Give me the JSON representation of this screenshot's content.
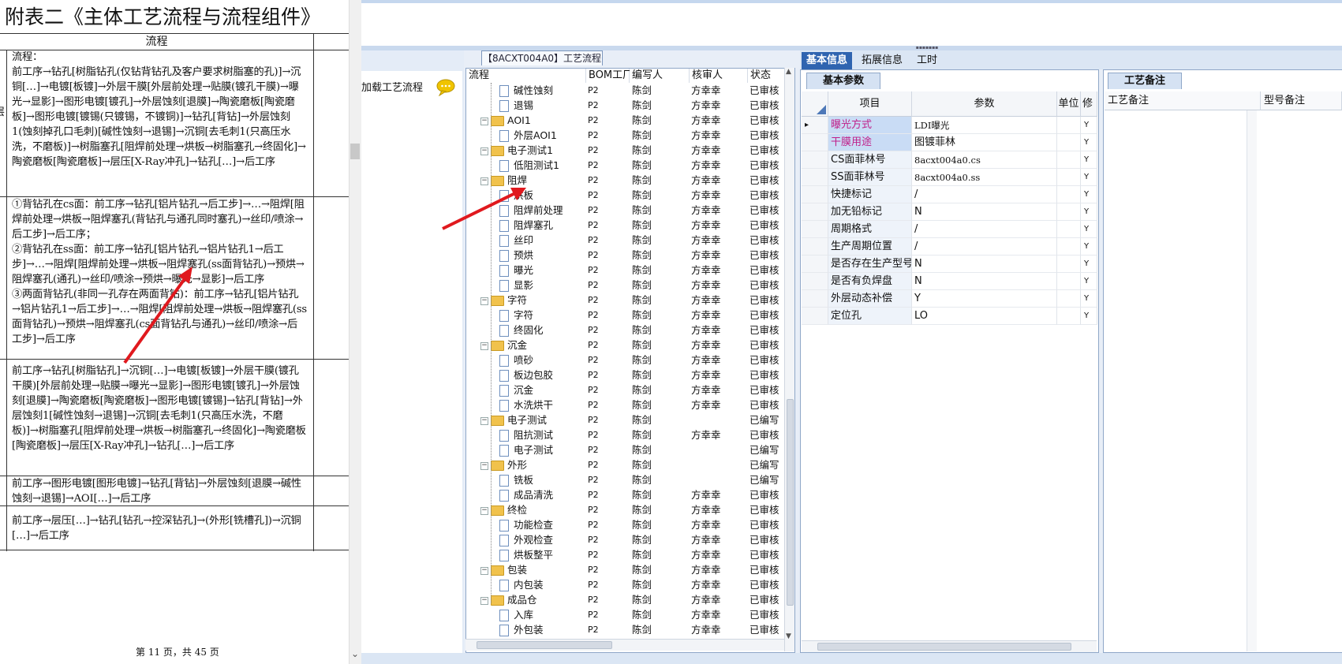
{
  "document": {
    "title": "附表二《主体工艺流程与流程组件》",
    "column_header": "流程",
    "left_mark": "层",
    "cells": [
      "流程：\n前工序→钻孔[树脂钻孔(仅钻背钻孔及客户要求树脂塞的孔)]→沉铜[…]→电镀[板镀]→外层干膜[外层前处理→贴膜(镀孔干膜)→曝光→显影]→图形电镀[镀孔]→外层蚀刻[退膜]→陶瓷磨板[陶瓷磨板]→图形电镀[镀锡(只镀锡，不镀铜)]→钻孔[背钻]→外层蚀刻1(蚀刻掉孔口毛刺)[碱性蚀刻→退锡]→沉铜[去毛刺1(只高压水洗，不磨板)]→树脂塞孔[阻焊前处理→烘板→树脂塞孔→终固化]→陶瓷磨板[陶瓷磨板]→层压[X-Ray冲孔]→钻孔[…]→后工序",
      "①背钻孔在cs面：前工序→钻孔[铝片钻孔→后工步]→…→阻焊[阻焊前处理→烘板→阻焊塞孔(背钻孔与通孔同时塞孔)→丝印/喷涂→后工步]→后工序；\n②背钻孔在ss面：前工序→钻孔[铝片钻孔→铝片钻孔1→后工步]→…→阻焊[阻焊前处理→烘板→阻焊塞孔(ss面背钻孔)→预烘→阻焊塞孔(通孔)→丝印/喷涂→预烘→曝光→显影]→后工序\n③两面背钻孔(非同一孔存在两面背钻)：前工序→钻孔[铝片钻孔→铝片钻孔1→后工步]→…→阻焊[阻焊前处理→烘板→阻焊塞孔(ss面背钻孔)→预烘→阻焊塞孔(cs面背钻孔与通孔)→丝印/喷涂→后工步]→后工序",
      "前工序→钻孔[树脂钻孔]→沉铜[…]→电镀[板镀]→外层干膜(镀孔干膜)[外层前处理→贴膜→曝光→显影]→图形电镀[镀孔]→外层蚀刻[退膜]→陶瓷磨板[陶瓷磨板]→图形电镀[镀锡]→钻孔[背钻]→外层蚀刻1[碱性蚀刻→退锡]→沉铜[去毛刺1(只高压水洗，不磨板)]→树脂塞孔[阻焊前处理→烘板→树脂塞孔→终固化]→陶瓷磨板[陶瓷磨板]→层压[X-Ray冲孔]→钻孔[…]→后工序",
      "前工序→图形电镀[图形电镀]→钻孔[背钻]→外层蚀刻[退膜→碱性蚀刻→退锡]→AOI[…]→后工序",
      "前工序→层压[…]→钻孔[钻孔→控深钻孔]→(外形[铣槽孔])→沉铜[…]→后工序"
    ],
    "page_number": "第 11 页，共 45 页"
  },
  "left_panel": {
    "load_label": "加载工艺流程",
    "icon": "speech-bubble-icon"
  },
  "tree": {
    "tab_label": "【8ACXT004A0】工艺流程",
    "columns": [
      "流程",
      "BOM工厂",
      "编写人",
      "核审人",
      "状态"
    ],
    "rows": [
      {
        "name": "碱性蚀刻",
        "level": 1,
        "bom": "P2",
        "writer": "陈剑",
        "reviewer": "方幸幸",
        "status": "已审核"
      },
      {
        "name": "退锡",
        "level": 1,
        "bom": "P2",
        "writer": "陈剑",
        "reviewer": "方幸幸",
        "status": "已审核"
      },
      {
        "name": "AOI1",
        "level": 0,
        "bom": "P2",
        "writer": "陈剑",
        "reviewer": "方幸幸",
        "status": "已审核"
      },
      {
        "name": "外层AOI1",
        "level": 1,
        "bom": "P2",
        "writer": "陈剑",
        "reviewer": "方幸幸",
        "status": "已审核"
      },
      {
        "name": "电子测试1",
        "level": 0,
        "bom": "P2",
        "writer": "陈剑",
        "reviewer": "方幸幸",
        "status": "已审核"
      },
      {
        "name": "低阻测试1",
        "level": 1,
        "bom": "P2",
        "writer": "陈剑",
        "reviewer": "方幸幸",
        "status": "已审核"
      },
      {
        "name": "阻焊",
        "level": 0,
        "bom": "P2",
        "writer": "陈剑",
        "reviewer": "方幸幸",
        "status": "已审核"
      },
      {
        "name": "烘板",
        "level": 1,
        "bom": "P2",
        "writer": "陈剑",
        "reviewer": "方幸幸",
        "status": "已审核"
      },
      {
        "name": "阻焊前处理",
        "level": 1,
        "bom": "P2",
        "writer": "陈剑",
        "reviewer": "方幸幸",
        "status": "已审核"
      },
      {
        "name": "阻焊塞孔",
        "level": 1,
        "bom": "P2",
        "writer": "陈剑",
        "reviewer": "方幸幸",
        "status": "已审核"
      },
      {
        "name": "丝印",
        "level": 1,
        "bom": "P2",
        "writer": "陈剑",
        "reviewer": "方幸幸",
        "status": "已审核"
      },
      {
        "name": "预烘",
        "level": 1,
        "bom": "P2",
        "writer": "陈剑",
        "reviewer": "方幸幸",
        "status": "已审核"
      },
      {
        "name": "曝光",
        "level": 1,
        "bom": "P2",
        "writer": "陈剑",
        "reviewer": "方幸幸",
        "status": "已审核"
      },
      {
        "name": "显影",
        "level": 1,
        "bom": "P2",
        "writer": "陈剑",
        "reviewer": "方幸幸",
        "status": "已审核"
      },
      {
        "name": "字符",
        "level": 0,
        "bom": "P2",
        "writer": "陈剑",
        "reviewer": "方幸幸",
        "status": "已审核"
      },
      {
        "name": "字符",
        "level": 1,
        "bom": "P2",
        "writer": "陈剑",
        "reviewer": "方幸幸",
        "status": "已审核"
      },
      {
        "name": "终固化",
        "level": 1,
        "bom": "P2",
        "writer": "陈剑",
        "reviewer": "方幸幸",
        "status": "已审核"
      },
      {
        "name": "沉金",
        "level": 0,
        "bom": "P2",
        "writer": "陈剑",
        "reviewer": "方幸幸",
        "status": "已审核"
      },
      {
        "name": "喷砂",
        "level": 1,
        "bom": "P2",
        "writer": "陈剑",
        "reviewer": "方幸幸",
        "status": "已审核"
      },
      {
        "name": "板边包胶",
        "level": 1,
        "bom": "P2",
        "writer": "陈剑",
        "reviewer": "方幸幸",
        "status": "已审核"
      },
      {
        "name": "沉金",
        "level": 1,
        "bom": "P2",
        "writer": "陈剑",
        "reviewer": "方幸幸",
        "status": "已审核"
      },
      {
        "name": "水洗烘干",
        "level": 1,
        "bom": "P2",
        "writer": "陈剑",
        "reviewer": "方幸幸",
        "status": "已审核"
      },
      {
        "name": "电子测试",
        "level": 0,
        "bom": "P2",
        "writer": "陈剑",
        "reviewer": "",
        "status": "已编写"
      },
      {
        "name": "阻抗测试",
        "level": 1,
        "bom": "P2",
        "writer": "陈剑",
        "reviewer": "方幸幸",
        "status": "已审核"
      },
      {
        "name": "电子测试",
        "level": 1,
        "bom": "P2",
        "writer": "陈剑",
        "reviewer": "",
        "status": "已编写"
      },
      {
        "name": "外形",
        "level": 0,
        "bom": "P2",
        "writer": "陈剑",
        "reviewer": "",
        "status": "已编写"
      },
      {
        "name": "铣板",
        "level": 1,
        "bom": "P2",
        "writer": "陈剑",
        "reviewer": "",
        "status": "已编写"
      },
      {
        "name": "成品清洗",
        "level": 1,
        "bom": "P2",
        "writer": "陈剑",
        "reviewer": "方幸幸",
        "status": "已审核"
      },
      {
        "name": "终检",
        "level": 0,
        "bom": "P2",
        "writer": "陈剑",
        "reviewer": "方幸幸",
        "status": "已审核"
      },
      {
        "name": "功能检查",
        "level": 1,
        "bom": "P2",
        "writer": "陈剑",
        "reviewer": "方幸幸",
        "status": "已审核"
      },
      {
        "name": "外观检查",
        "level": 1,
        "bom": "P2",
        "writer": "陈剑",
        "reviewer": "方幸幸",
        "status": "已审核"
      },
      {
        "name": "烘板整平",
        "level": 1,
        "bom": "P2",
        "writer": "陈剑",
        "reviewer": "方幸幸",
        "status": "已审核"
      },
      {
        "name": "包装",
        "level": 0,
        "bom": "P2",
        "writer": "陈剑",
        "reviewer": "方幸幸",
        "status": "已审核"
      },
      {
        "name": "内包装",
        "level": 1,
        "bom": "P2",
        "writer": "陈剑",
        "reviewer": "方幸幸",
        "status": "已审核"
      },
      {
        "name": "成品仓",
        "level": 0,
        "bom": "P2",
        "writer": "陈剑",
        "reviewer": "方幸幸",
        "status": "已审核"
      },
      {
        "name": "入库",
        "level": 1,
        "bom": "P2",
        "writer": "陈剑",
        "reviewer": "方幸幸",
        "status": "已审核"
      },
      {
        "name": "外包装",
        "level": 1,
        "bom": "P2",
        "writer": "陈剑",
        "reviewer": "方幸幸",
        "status": "已审核"
      }
    ]
  },
  "detail": {
    "tabs": [
      "基本信息",
      "拓展信息",
      "工时"
    ],
    "basic_subtab": "基本参数",
    "param_columns": [
      "项目",
      "参数",
      "单位",
      "修改"
    ],
    "params": [
      {
        "item": "曝光方式",
        "value": "LDI曝光",
        "unit": "",
        "flag": "Y",
        "highlight": true
      },
      {
        "item": "干膜用途",
        "value": "图镀菲林",
        "unit": "",
        "flag": "Y",
        "highlight": true
      },
      {
        "item": "CS面菲林号",
        "value": "8acxt004a0.cs",
        "unit": "",
        "flag": "Y",
        "highlight": false
      },
      {
        "item": "SS面菲林号",
        "value": "8acxt004a0.ss",
        "unit": "",
        "flag": "Y",
        "highlight": false
      },
      {
        "item": "快捷标记",
        "value": "/",
        "unit": "",
        "flag": "Y",
        "highlight": false
      },
      {
        "item": "加无铅标记",
        "value": "N",
        "unit": "",
        "flag": "Y",
        "highlight": false
      },
      {
        "item": "周期格式",
        "value": "/",
        "unit": "",
        "flag": "Y",
        "highlight": false
      },
      {
        "item": "生产周期位置",
        "value": "/",
        "unit": "",
        "flag": "Y",
        "highlight": false
      },
      {
        "item": "是否存在生产型号",
        "value": "N",
        "unit": "",
        "flag": "Y",
        "highlight": false
      },
      {
        "item": "是否有负焊盘",
        "value": "N",
        "unit": "",
        "flag": "Y",
        "highlight": false
      },
      {
        "item": "外层动态补偿",
        "value": "Y",
        "unit": "",
        "flag": "Y",
        "highlight": false
      },
      {
        "item": "定位孔",
        "value": "LO",
        "unit": "",
        "flag": "Y",
        "highlight": false
      }
    ],
    "note_subtab": "工艺备注",
    "note_columns": [
      "工艺备注",
      "型号备注"
    ]
  },
  "colors": {
    "accent": "#2f64b0",
    "highlight_text": "#c0208a",
    "selected_row": "#c9dcf5",
    "arrow": "#e0191e"
  }
}
